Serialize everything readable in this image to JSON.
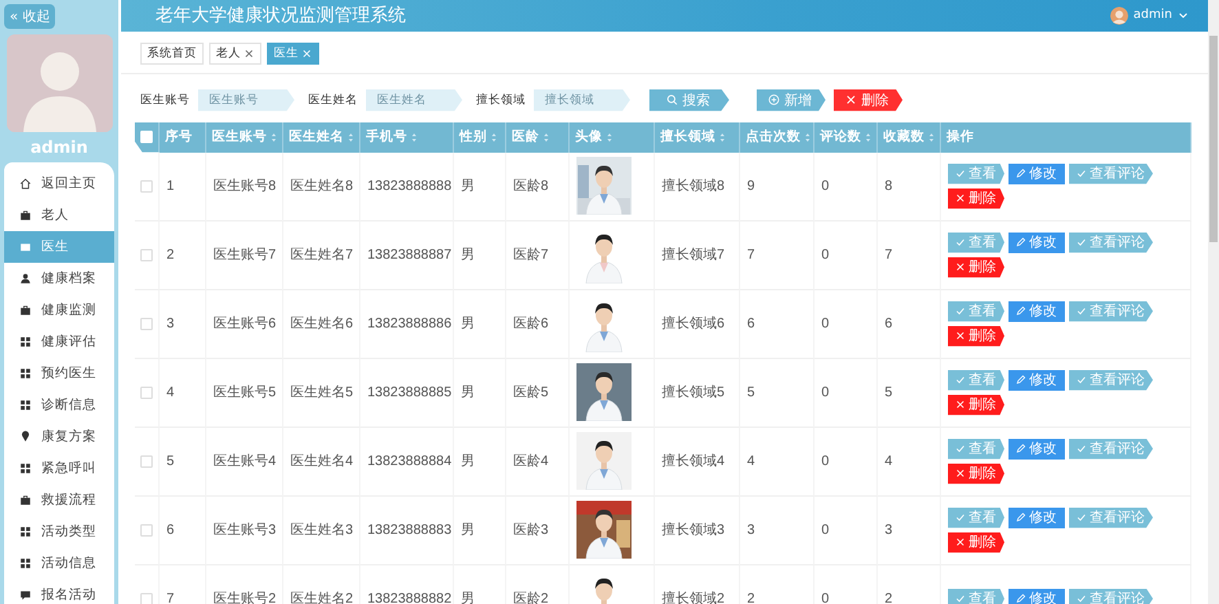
{
  "sidebar": {
    "collapse_button": "« 收起",
    "username": "admin",
    "menu": [
      {
        "label": "返回主页",
        "selected": false
      },
      {
        "label": "老人",
        "selected": false
      },
      {
        "label": "医生",
        "selected": true
      },
      {
        "label": "健康档案",
        "selected": false
      },
      {
        "label": "健康监测",
        "selected": false
      },
      {
        "label": "健康评估",
        "selected": false
      },
      {
        "label": "预约医生",
        "selected": false
      },
      {
        "label": "诊断信息",
        "selected": false
      },
      {
        "label": "康复方案",
        "selected": false
      },
      {
        "label": "紧急呼叫",
        "selected": false
      },
      {
        "label": "救援流程",
        "selected": false
      },
      {
        "label": "活动类型",
        "selected": false
      },
      {
        "label": "活动信息",
        "selected": false
      },
      {
        "label": "报名活动",
        "selected": false
      }
    ]
  },
  "header": {
    "title": "老年大学健康状况监测管理系统",
    "user": "admin"
  },
  "tabs": [
    {
      "label": "系统首页",
      "closable": false,
      "selected": false
    },
    {
      "label": "老人",
      "closable": true,
      "selected": false
    },
    {
      "label": "医生",
      "closable": true,
      "selected": true
    }
  ],
  "search": {
    "fields": [
      {
        "label": "医生账号",
        "placeholder": "医生账号"
      },
      {
        "label": "医生姓名",
        "placeholder": "医生姓名"
      },
      {
        "label": "擅长领域",
        "placeholder": "擅长领域"
      }
    ],
    "search_button": "搜索"
  },
  "toolbar": {
    "add_button": "新增",
    "delete_button": "删除"
  },
  "table": {
    "select_all_checked": false,
    "columns": [
      {
        "label": "序号",
        "sortable": false,
        "kind": "text"
      },
      {
        "label": "医生账号",
        "sortable": true,
        "kind": "text"
      },
      {
        "label": "医生姓名",
        "sortable": true,
        "kind": "text"
      },
      {
        "label": "手机号",
        "sortable": true,
        "kind": "text"
      },
      {
        "label": "性别",
        "sortable": true,
        "kind": "text"
      },
      {
        "label": "医龄",
        "sortable": true,
        "kind": "text"
      },
      {
        "label": "头像",
        "sortable": true
      },
      {
        "label": "擅长领域",
        "sortable": true,
        "kind": "text"
      },
      {
        "label": "点击次数",
        "sortable": true,
        "kind": "text"
      },
      {
        "label": "评论数",
        "sortable": true,
        "kind": "text"
      },
      {
        "label": "收藏数",
        "sortable": true,
        "kind": "text"
      },
      {
        "label": "操作",
        "sortable": false,
        "kind": "actions"
      }
    ],
    "rows": [
      {
        "checked": false,
        "cells": [
          "1",
          "医生账号8",
          "医生姓名8",
          "13823888888",
          "男",
          "医龄8",
          "",
          "擅长领域8",
          "9",
          "0",
          "8"
        ],
        "actions": [
          "查看",
          "修改",
          "查看评论",
          "删除"
        ]
      },
      {
        "checked": false,
        "cells": [
          "2",
          "医生账号7",
          "医生姓名7",
          "13823888887",
          "男",
          "医龄7",
          "",
          "擅长领域7",
          "7",
          "0",
          "7"
        ],
        "actions": [
          "查看",
          "修改",
          "查看评论",
          "删除"
        ]
      },
      {
        "checked": false,
        "cells": [
          "3",
          "医生账号6",
          "医生姓名6",
          "13823888886",
          "男",
          "医龄6",
          "",
          "擅长领域6",
          "6",
          "0",
          "6"
        ],
        "actions": [
          "查看",
          "修改",
          "查看评论",
          "删除"
        ]
      },
      {
        "checked": false,
        "cells": [
          "4",
          "医生账号5",
          "医生姓名5",
          "13823888885",
          "男",
          "医龄5",
          "",
          "擅长领域5",
          "5",
          "0",
          "5"
        ],
        "actions": [
          "查看",
          "修改",
          "查看评论",
          "删除"
        ]
      },
      {
        "checked": false,
        "cells": [
          "5",
          "医生账号4",
          "医生姓名4",
          "13823888884",
          "男",
          "医龄4",
          "",
          "擅长领域4",
          "4",
          "0",
          "4"
        ],
        "actions": [
          "查看",
          "修改",
          "查看评论",
          "删除"
        ]
      },
      {
        "checked": false,
        "cells": [
          "6",
          "医生账号3",
          "医生姓名3",
          "13823888883",
          "男",
          "医龄3",
          "",
          "擅长领域3",
          "3",
          "0",
          "3"
        ],
        "actions": [
          "查看",
          "修改",
          "查看评论",
          "删除"
        ]
      },
      {
        "checked": false,
        "cells": [
          "7",
          "医生账号2",
          "医生姓名2",
          "13823888882",
          "男",
          "医龄2",
          "",
          "擅长领域2",
          "2",
          "0",
          "2"
        ],
        "actions": [
          "查看",
          "修改",
          "查看评论"
        ]
      }
    ]
  }
}
